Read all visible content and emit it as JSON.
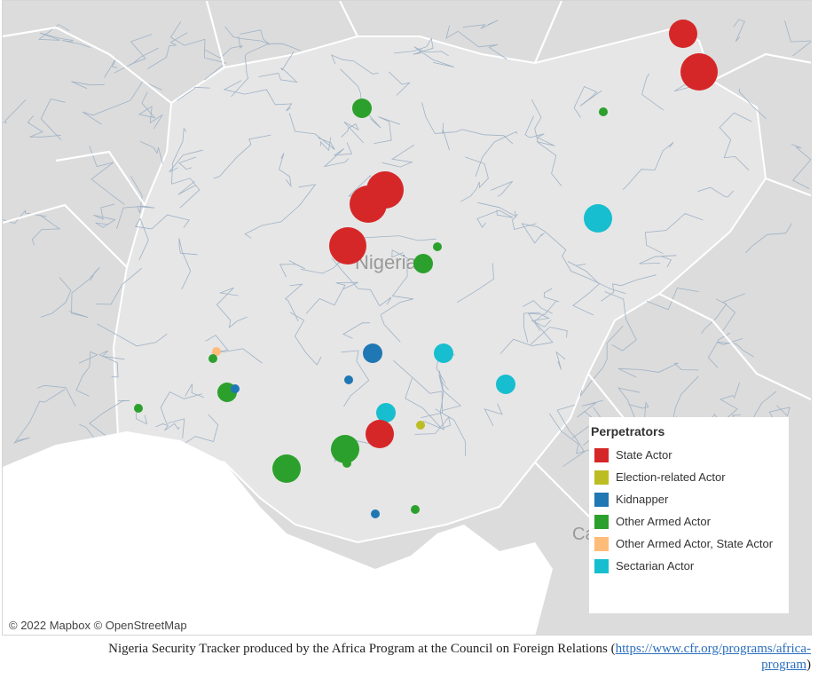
{
  "map": {
    "country_label": "Nigeria",
    "partial_label": "Ca",
    "colors": {
      "water": "#ffffff",
      "land": "#dcdcdc",
      "focus_land": "#e8e8e8",
      "border": "#ffffff",
      "rivers": "#9fb2c6"
    },
    "markers": [
      {
        "category": "State Actor",
        "size": "medium"
      },
      {
        "category": "State Actor",
        "size": "large"
      },
      {
        "category": "Other Armed Actor",
        "size": "small"
      },
      {
        "category": "Other Armed Actor",
        "size": "tiny"
      },
      {
        "category": "State Actor",
        "size": "large"
      },
      {
        "category": "State Actor",
        "size": "large"
      },
      {
        "category": "State Actor",
        "size": "large"
      },
      {
        "category": "Sectarian Actor",
        "size": "medium"
      },
      {
        "category": "Other Armed Actor",
        "size": "tiny"
      },
      {
        "category": "Other Armed Actor",
        "size": "small"
      },
      {
        "category": "Kidnapper",
        "size": "small"
      },
      {
        "category": "Sectarian Actor",
        "size": "small"
      },
      {
        "category": "Other Armed Actor, State Actor",
        "size": "tiny"
      },
      {
        "category": "Other Armed Actor",
        "size": "tiny"
      },
      {
        "category": "Kidnapper",
        "size": "tiny"
      },
      {
        "category": "Sectarian Actor",
        "size": "small"
      },
      {
        "category": "Other Armed Actor",
        "size": "small"
      },
      {
        "category": "Kidnapper",
        "size": "tiny"
      },
      {
        "category": "Other Armed Actor",
        "size": "tiny"
      },
      {
        "category": "Sectarian Actor",
        "size": "small"
      },
      {
        "category": "Election-related Actor",
        "size": "tiny"
      },
      {
        "category": "State Actor",
        "size": "medium"
      },
      {
        "category": "Other Armed Actor",
        "size": "medium"
      },
      {
        "category": "Other Armed Actor",
        "size": "tiny"
      },
      {
        "category": "Other Armed Actor",
        "size": "medium"
      },
      {
        "category": "Kidnapper",
        "size": "tiny"
      },
      {
        "category": "Other Armed Actor",
        "size": "tiny"
      }
    ]
  },
  "legend": {
    "title": "Perpetrators",
    "items": [
      {
        "label": "State Actor",
        "color": "#d62728"
      },
      {
        "label": "Election-related Actor",
        "color": "#bcbd22"
      },
      {
        "label": "Kidnapper",
        "color": "#1f77b4"
      },
      {
        "label": "Other Armed Actor",
        "color": "#2ca02c"
      },
      {
        "label": "Other Armed Actor, State Actor",
        "color": "#ffbb78"
      },
      {
        "label": "Sectarian Actor",
        "color": "#17becf"
      }
    ]
  },
  "attribution": "© 2022 Mapbox  © OpenStreetMap",
  "caption": {
    "text_before": "Nigeria Security Tracker produced by the Africa Program at the Council on Foreign Relations (",
    "link_part1": "https://www.cfr.org/programs/africa-",
    "link_part2": "program",
    "text_after": ")"
  }
}
